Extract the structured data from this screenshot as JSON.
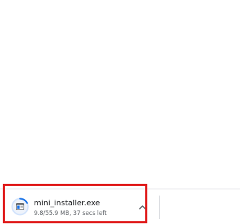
{
  "download": {
    "file_name": "mini_installer.exe",
    "status": "9.8/55.9 MB, 37 secs left",
    "progress": 0.175,
    "progress_label_icon": "download-progress-ring",
    "file_icon": "installer-window-icon",
    "menu_icon": "chevron-up-icon"
  },
  "colors": {
    "highlight": "#e01b1b",
    "progress": "#1a73e8",
    "progress_track": "#d2e3fc",
    "text_primary": "#202124",
    "text_secondary": "#5f6368"
  }
}
